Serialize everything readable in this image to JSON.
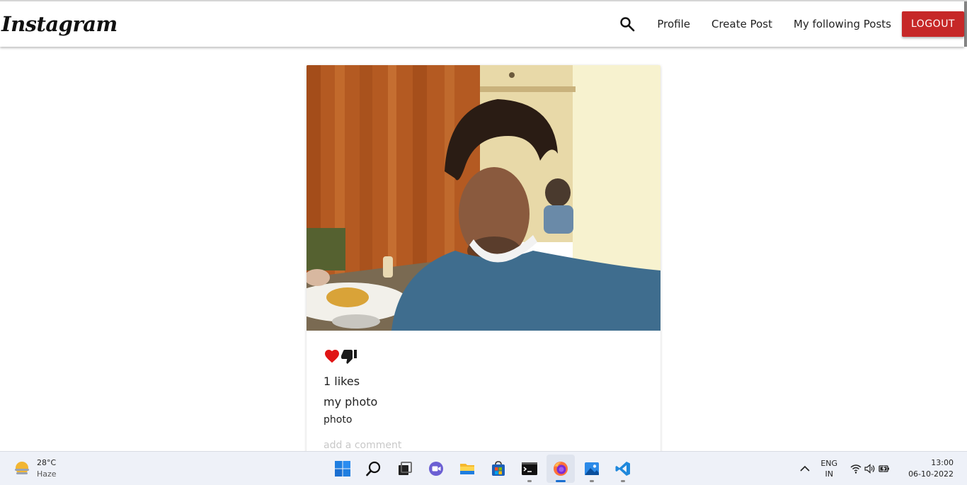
{
  "navbar": {
    "brand": "Instagram",
    "links": [
      "Profile",
      "Create Post",
      "My following Posts"
    ],
    "logout_label": "LOGOUT",
    "logout_color": "#c62828"
  },
  "post": {
    "likes_text": "1 likes",
    "title": "my photo",
    "body": "photo",
    "comment_placeholder": "add a comment",
    "like_icon": "heart-icon",
    "unlike_icon": "thumb-down-icon",
    "heart_color": "#e01515"
  },
  "taskbar": {
    "weather": {
      "temp": "28°C",
      "condition": "Haze"
    },
    "apps": [
      "start",
      "search",
      "task-view",
      "teams-chat",
      "file-explorer",
      "microsoft-store",
      "terminal",
      "firefox",
      "photos",
      "vscode"
    ],
    "active_app": "firefox",
    "lang": {
      "line1": "ENG",
      "line2": "IN"
    },
    "clock": {
      "time": "13:00",
      "date": "06-10-2022"
    }
  }
}
